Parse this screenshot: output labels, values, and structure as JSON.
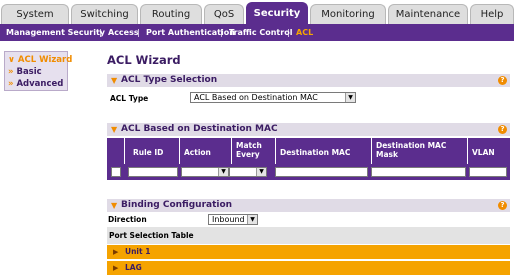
{
  "tabs": [
    {
      "label": "System",
      "active": false
    },
    {
      "label": "Switching",
      "active": false
    },
    {
      "label": "Routing",
      "active": false
    },
    {
      "label": "QoS",
      "active": false
    },
    {
      "label": "Security",
      "active": true
    },
    {
      "label": "Monitoring",
      "active": false
    },
    {
      "label": "Maintenance",
      "active": false
    },
    {
      "label": "Help",
      "active": false
    }
  ],
  "subnav": [
    {
      "label": "Management Security"
    },
    {
      "label": "Access"
    },
    {
      "label": "Port Authentication"
    },
    {
      "label": "Traffic Control"
    },
    {
      "label": "ACL",
      "active": true
    }
  ],
  "subnav_separator": "|",
  "sidebar": {
    "items": [
      {
        "label": "ACL Wizard",
        "active": true
      },
      {
        "label": "Basic"
      },
      {
        "label": "Advanced"
      }
    ],
    "arrow_glyph": "»"
  },
  "page_title": "ACL Wizard",
  "acl_type_section": {
    "title": "ACL Type Selection",
    "field_label": "ACL Type",
    "selected": "ACL Based on Destination MAC"
  },
  "dest_mac_section": {
    "title": "ACL Based on Destination MAC",
    "columns": [
      "Rule ID",
      "Action",
      "Match Every",
      "Destination MAC",
      "Destination MAC Mask",
      "VLAN"
    ]
  },
  "binding_section": {
    "title": "Binding Configuration",
    "direction_label": "Direction",
    "direction_value": "Inbound",
    "port_table_label": "Port Selection Table",
    "rows": [
      "Unit 1",
      "LAG"
    ]
  },
  "help_glyph": "?",
  "colors": {
    "brand_purple": "#5b2d8e",
    "accent_orange": "#f08c00",
    "row_orange": "#f5a300"
  }
}
